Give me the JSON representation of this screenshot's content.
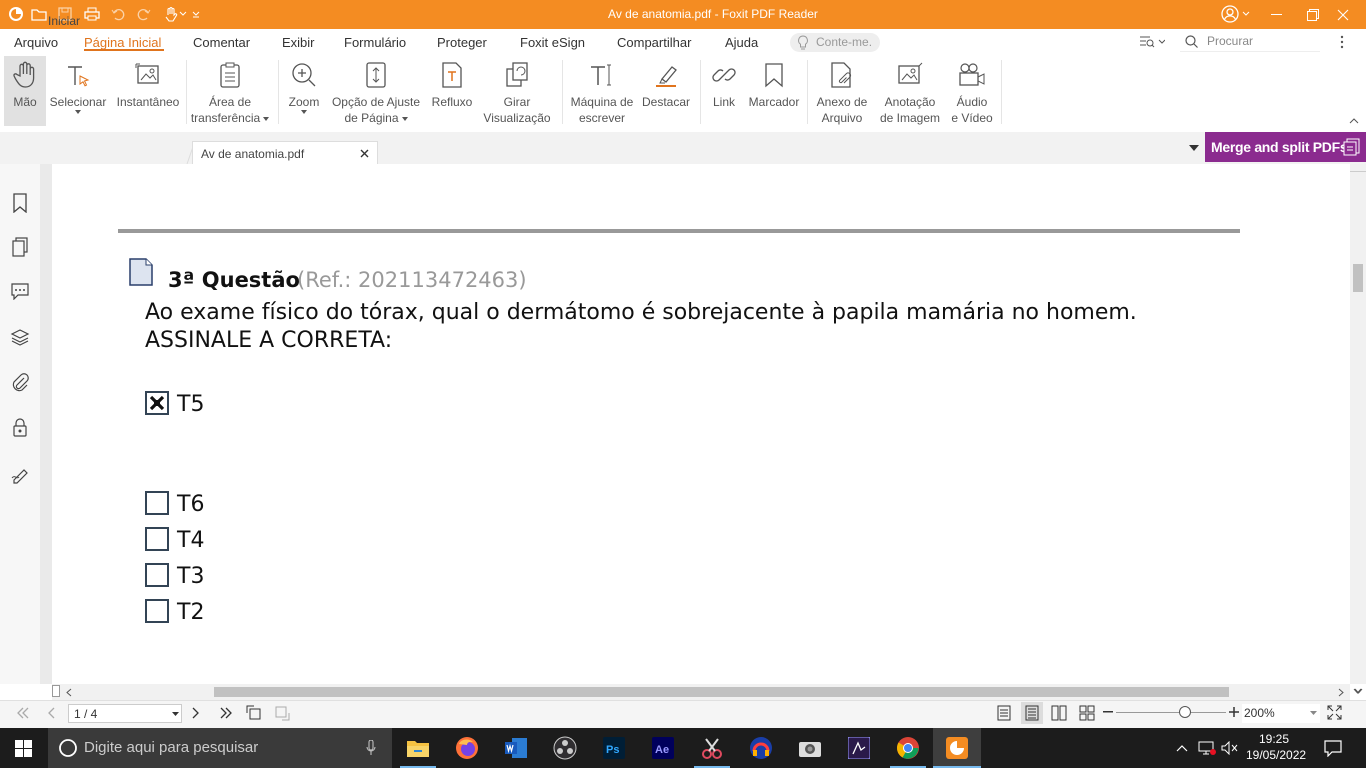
{
  "window": {
    "title": "Av de anatomia.pdf - Foxit PDF Reader"
  },
  "menu": {
    "items": [
      "Arquivo",
      "Página Inicial",
      "Comentar",
      "Exibir",
      "Formulário",
      "Proteger",
      "Foxit eSign",
      "Compartilhar",
      "Ajuda"
    ],
    "tell_me": "Conte-me.",
    "search_placeholder": "Procurar"
  },
  "ribbon": {
    "mao": "Mão",
    "selecionar": "Selecionar",
    "instantaneo": "Instantâneo",
    "area1": "Área de",
    "area2": "transferência",
    "zoom": "Zoom",
    "ajuste1": "Opção de Ajuste",
    "ajuste2": "de Página",
    "refluxo": "Refluxo",
    "girar1": "Girar",
    "girar2": "Visualização",
    "maquina1": "Máquina de",
    "maquina2": "escrever",
    "destacar": "Destacar",
    "link": "Link",
    "marcador": "Marcador",
    "anexo1": "Anexo de",
    "anexo2": "Arquivo",
    "anotacao1": "Anotação",
    "anotacao2": "de Imagem",
    "audio1": "Áudio",
    "audio2": "e Vídeo"
  },
  "tabs": [
    {
      "label": "Iniciar"
    },
    {
      "label": "Av de anatomia.pdf"
    }
  ],
  "banner": {
    "label": "Merge and split PDFs"
  },
  "document": {
    "question_title": "3ª Questão",
    "question_ref": "(Ref.: 202113472463)",
    "question_line1": "Ao exame físico do tórax, qual o dermátomo é sobrejacente à papila mamária no homem.",
    "question_line2": "ASSINALE A CORRETA:",
    "options": [
      {
        "label": "T5",
        "checked": true
      },
      {
        "label": "T6",
        "checked": false
      },
      {
        "label": "T4",
        "checked": false
      },
      {
        "label": "T3",
        "checked": false
      },
      {
        "label": "T2",
        "checked": false
      }
    ]
  },
  "statusbar": {
    "page": "1 / 4",
    "zoom": "200%",
    "zoom_level_percent": 63
  },
  "taskbar": {
    "search_placeholder": "Digite aqui para pesquisar",
    "time": "19:25",
    "date": "19/05/2022"
  },
  "colors": {
    "brand": "#f48c22",
    "accent": "#e0741d",
    "banner": "#8b2b8f"
  }
}
